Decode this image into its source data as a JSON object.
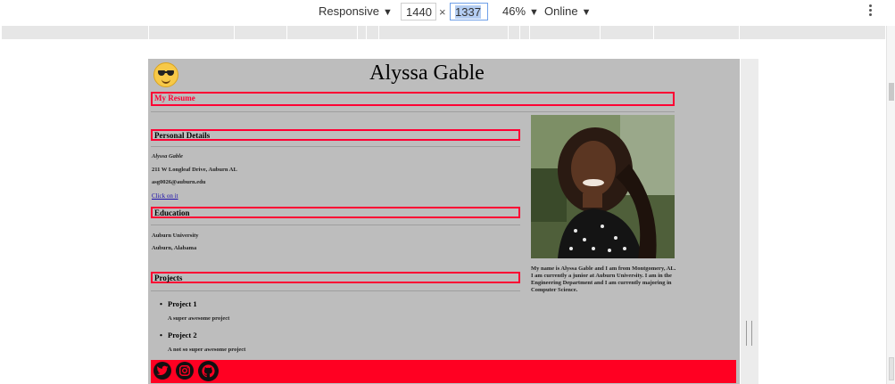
{
  "toolbar": {
    "device": "Responsive",
    "width": "1440",
    "height": "1337",
    "times": "×",
    "zoom": "46%",
    "network": "Online"
  },
  "page": {
    "name": "Alyssa Gable",
    "my_resume": "My Resume",
    "personal_details": {
      "heading": "Personal Details",
      "name": "Alyssa Gable",
      "address": "211 W Longleaf Drive, Auburn AL",
      "email": "asg0026@auburn.edu",
      "link": "Click on it"
    },
    "education": {
      "heading": "Education",
      "school": "Auburn University",
      "location": "Auburn, Alabama"
    },
    "projects": {
      "heading": "Projects",
      "items": [
        {
          "title": "Project 1",
          "desc": "A super awesome project"
        },
        {
          "title": "Project 2",
          "desc": "A not so super awesome project"
        }
      ]
    },
    "bio": "My name is Alyssa Gable and I am from Montgomery, AL. I am currently a junior at Auburn University. I am in the Engineering Department and I am currently majoring in Computer Science.",
    "footer_icons": [
      "twitter-icon",
      "instagram-icon",
      "github-icon"
    ]
  },
  "colors": {
    "accent": "#ff0022",
    "page_bg": "#bdbdbd"
  }
}
